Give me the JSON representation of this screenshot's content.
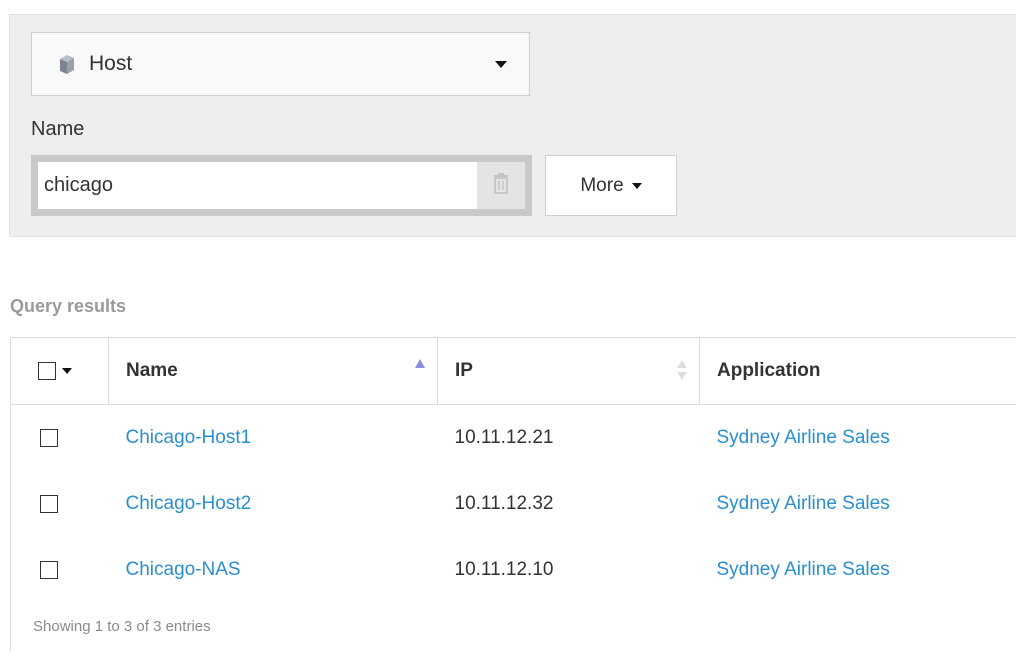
{
  "filter": {
    "object_type": "Host",
    "name_label": "Name",
    "name_value": "chicago",
    "more_label": "More"
  },
  "results": {
    "title": "Query results",
    "columns": [
      "Name",
      "IP",
      "Application"
    ],
    "rows": [
      {
        "name": "Chicago-Host1",
        "ip": "10.11.12.21",
        "application": "Sydney Airline Sales"
      },
      {
        "name": "Chicago-Host2",
        "ip": "10.11.12.32",
        "application": "Sydney Airline Sales"
      },
      {
        "name": "Chicago-NAS",
        "ip": "10.11.12.10",
        "application": "Sydney Airline Sales"
      }
    ],
    "footer": "Showing 1 to 3 of 3 entries"
  },
  "colors": {
    "link": "#2a8fd1",
    "panel_bg": "#eeeeee",
    "sort_active": "#8c8ce0"
  },
  "icons": {
    "object_type": "host-icon",
    "clear": "trash-icon",
    "sort_name": "sort-ascending-icon",
    "sort_ip": "sort-both-icon"
  }
}
